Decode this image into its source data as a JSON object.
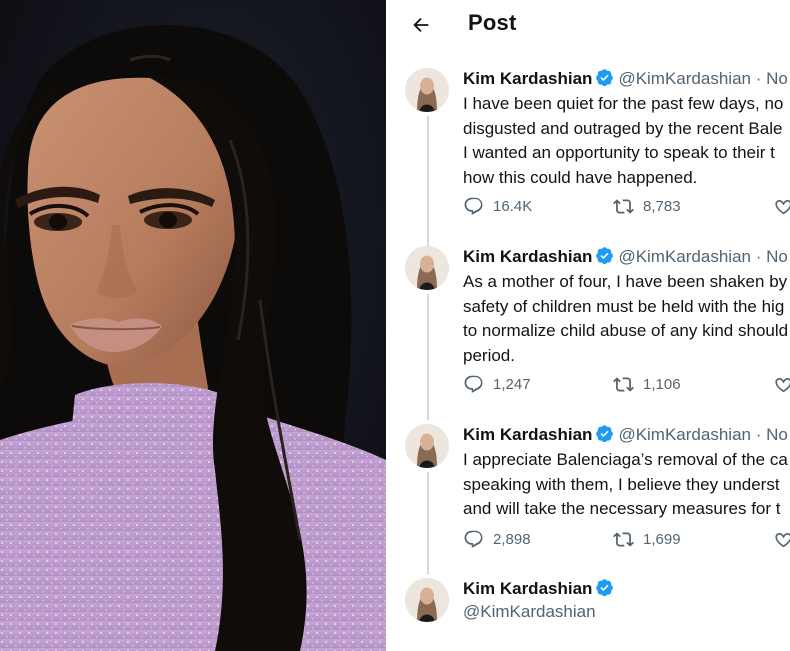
{
  "header": {
    "title": "Post"
  },
  "tweets": [
    {
      "name": "Kim Kardashian",
      "handle": "@KimKardashian",
      "date": "No",
      "lines": [
        "I have been quiet for the past few days, no",
        "disgusted and outraged by the recent Bale",
        "I wanted an opportunity to speak to their t",
        "how this could have happened."
      ],
      "replies": "16.4K",
      "reposts": "8,783"
    },
    {
      "name": "Kim Kardashian",
      "handle": "@KimKardashian",
      "date": "No",
      "lines": [
        "As a mother of four, I have been shaken by",
        "safety of children must be held with the hig",
        "to normalize child abuse of any kind should",
        "period."
      ],
      "replies": "1,247",
      "reposts": "1,106"
    },
    {
      "name": "Kim Kardashian",
      "handle": "@KimKardashian",
      "date": "No",
      "lines": [
        "I appreciate Balenciaga’s removal of the ca",
        "speaking with them, I believe they underst",
        "and will take the necessary measures for t"
      ],
      "replies": "2,898",
      "reposts": "1,699"
    }
  ],
  "main_tweet": {
    "name": "Kim Kardashian",
    "handle": "@KimKardashian"
  },
  "colors": {
    "text": "#0f1419",
    "muted": "#536471",
    "verified": "#1d9bf0",
    "thread_line": "#cfd9de"
  },
  "icons": [
    "back-arrow-icon",
    "verified-badge-icon",
    "reply-icon",
    "repost-icon",
    "like-icon"
  ]
}
